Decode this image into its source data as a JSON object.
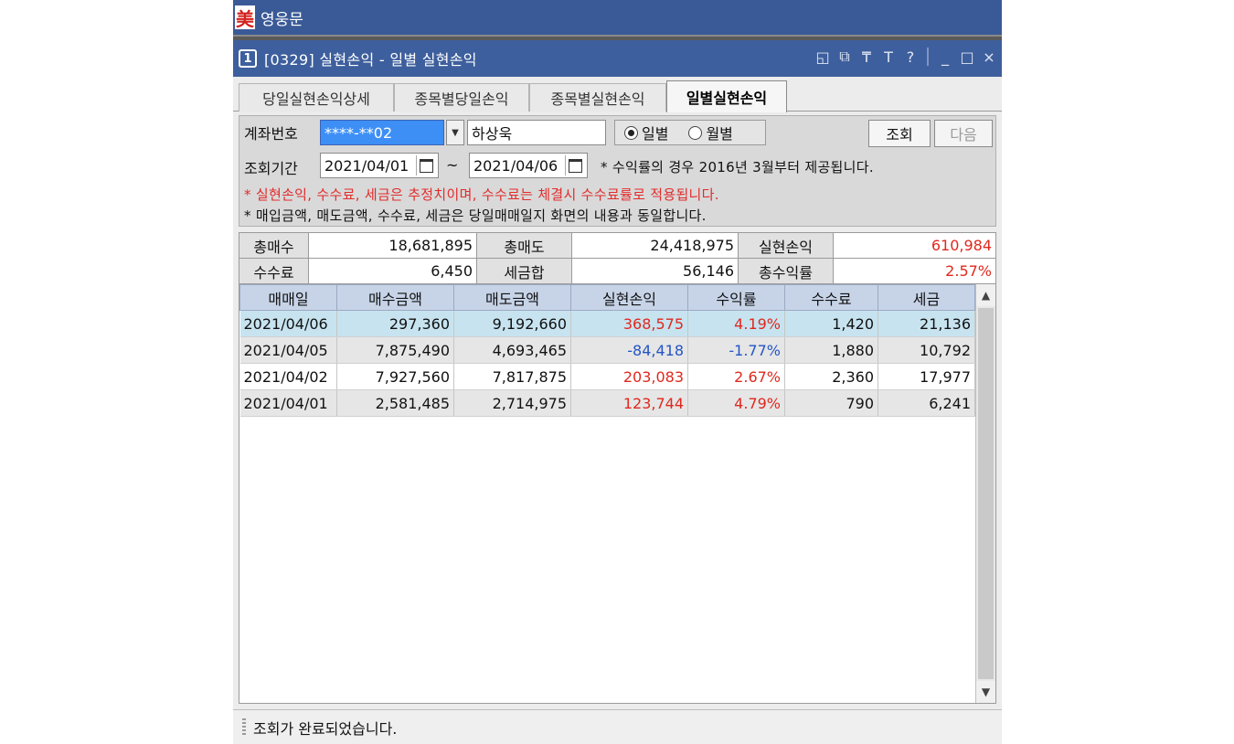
{
  "app": {
    "logo_glyph": "美",
    "name": "영웅문"
  },
  "window": {
    "number": "1",
    "title": "[0329] 실현손익 - 일별 실현손익",
    "controls": [
      "◱",
      "⧉",
      "₸",
      "T",
      "?",
      "_",
      "□",
      "×"
    ]
  },
  "tabs": [
    {
      "label": "당일실현손익상세"
    },
    {
      "label": "종목별당일손익"
    },
    {
      "label": "종목별실현손익"
    },
    {
      "label": "일별실현손익"
    }
  ],
  "form": {
    "account_label": "계좌번호",
    "account_value": "****-**02",
    "account_name": "하상욱",
    "radio_daily": "일별",
    "radio_monthly": "월별",
    "query_button": "조회",
    "next_button": "다음",
    "period_label": "조회기간",
    "date_from": "2021/04/01",
    "date_sep": "~",
    "date_to": "2021/04/06",
    "period_note": "* 수익률의 경우 2016년 3월부터 제공됩니다.",
    "note_red": "* 실현손익, 수수료, 세금은 추정치이며, 수수료는 체결시 수수료률로 적용됩니다.",
    "note_black": "* 매입금액, 매도금액, 수수료, 세금은 당일매매일지 화면의 내용과 동일합니다."
  },
  "summary": {
    "total_buy_label": "총매수",
    "total_buy": "18,681,895",
    "total_sell_label": "총매도",
    "total_sell": "24,418,975",
    "realized_label": "실현손익",
    "realized": "610,984",
    "fee_label": "수수료",
    "fee": "6,450",
    "tax_label": "세금합",
    "tax": "56,146",
    "return_label": "총수익률",
    "return": "2.57%"
  },
  "grid": {
    "headers": [
      "매매일",
      "매수금액",
      "매도금액",
      "실현손익",
      "수익률",
      "수수료",
      "세금"
    ],
    "rows": [
      [
        "2021/04/06",
        "297,360",
        "9,192,660",
        "368,575",
        "4.19%",
        "1,420",
        "21,136"
      ],
      [
        "2021/04/05",
        "7,875,490",
        "4,693,465",
        "-84,418",
        "-1.77%",
        "1,880",
        "10,792"
      ],
      [
        "2021/04/02",
        "7,927,560",
        "7,817,875",
        "203,083",
        "2.67%",
        "2,360",
        "17,977"
      ],
      [
        "2021/04/01",
        "2,581,485",
        "2,714,975",
        "123,744",
        "4.79%",
        "790",
        "6,241"
      ]
    ]
  },
  "status": {
    "message": "조회가 완료되었습니다."
  },
  "colors": {
    "titlebar": "#3e5f9d",
    "positive": "#e0281e",
    "negative": "#2455c4",
    "selected_row": "#c7e3ef"
  }
}
